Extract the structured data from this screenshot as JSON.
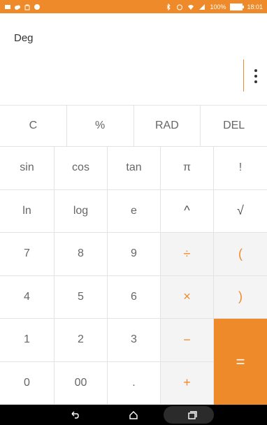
{
  "status_bar": {
    "left_icons": [
      "mail-icon",
      "cloud-icon",
      "bag-icon",
      "face-icon"
    ],
    "right_icons": [
      "bluetooth-icon",
      "alarm-icon",
      "wifi-icon",
      "signal-icon"
    ],
    "battery_percent": "100%",
    "time": "18:01",
    "background": "#ef8a2a"
  },
  "display": {
    "mode": "Deg",
    "menu_icon": "more-vertical-icon"
  },
  "keypad": {
    "row1": [
      "C",
      "%",
      "RAD",
      "DEL"
    ],
    "rows": [
      [
        "sin",
        "cos",
        "tan",
        "π",
        "!"
      ],
      [
        "ln",
        "log",
        "e",
        "^",
        "√"
      ],
      [
        "7",
        "8",
        "9",
        "÷",
        "("
      ],
      [
        "4",
        "5",
        "6",
        "×",
        ")"
      ],
      [
        "1",
        "2",
        "3",
        "−"
      ],
      [
        "0",
        "00",
        ".",
        "+"
      ]
    ],
    "equals": "=",
    "accent": "#ef8a2a"
  },
  "nav_bar": {
    "buttons": [
      "back-icon",
      "home-icon",
      "recents-icon"
    ]
  }
}
